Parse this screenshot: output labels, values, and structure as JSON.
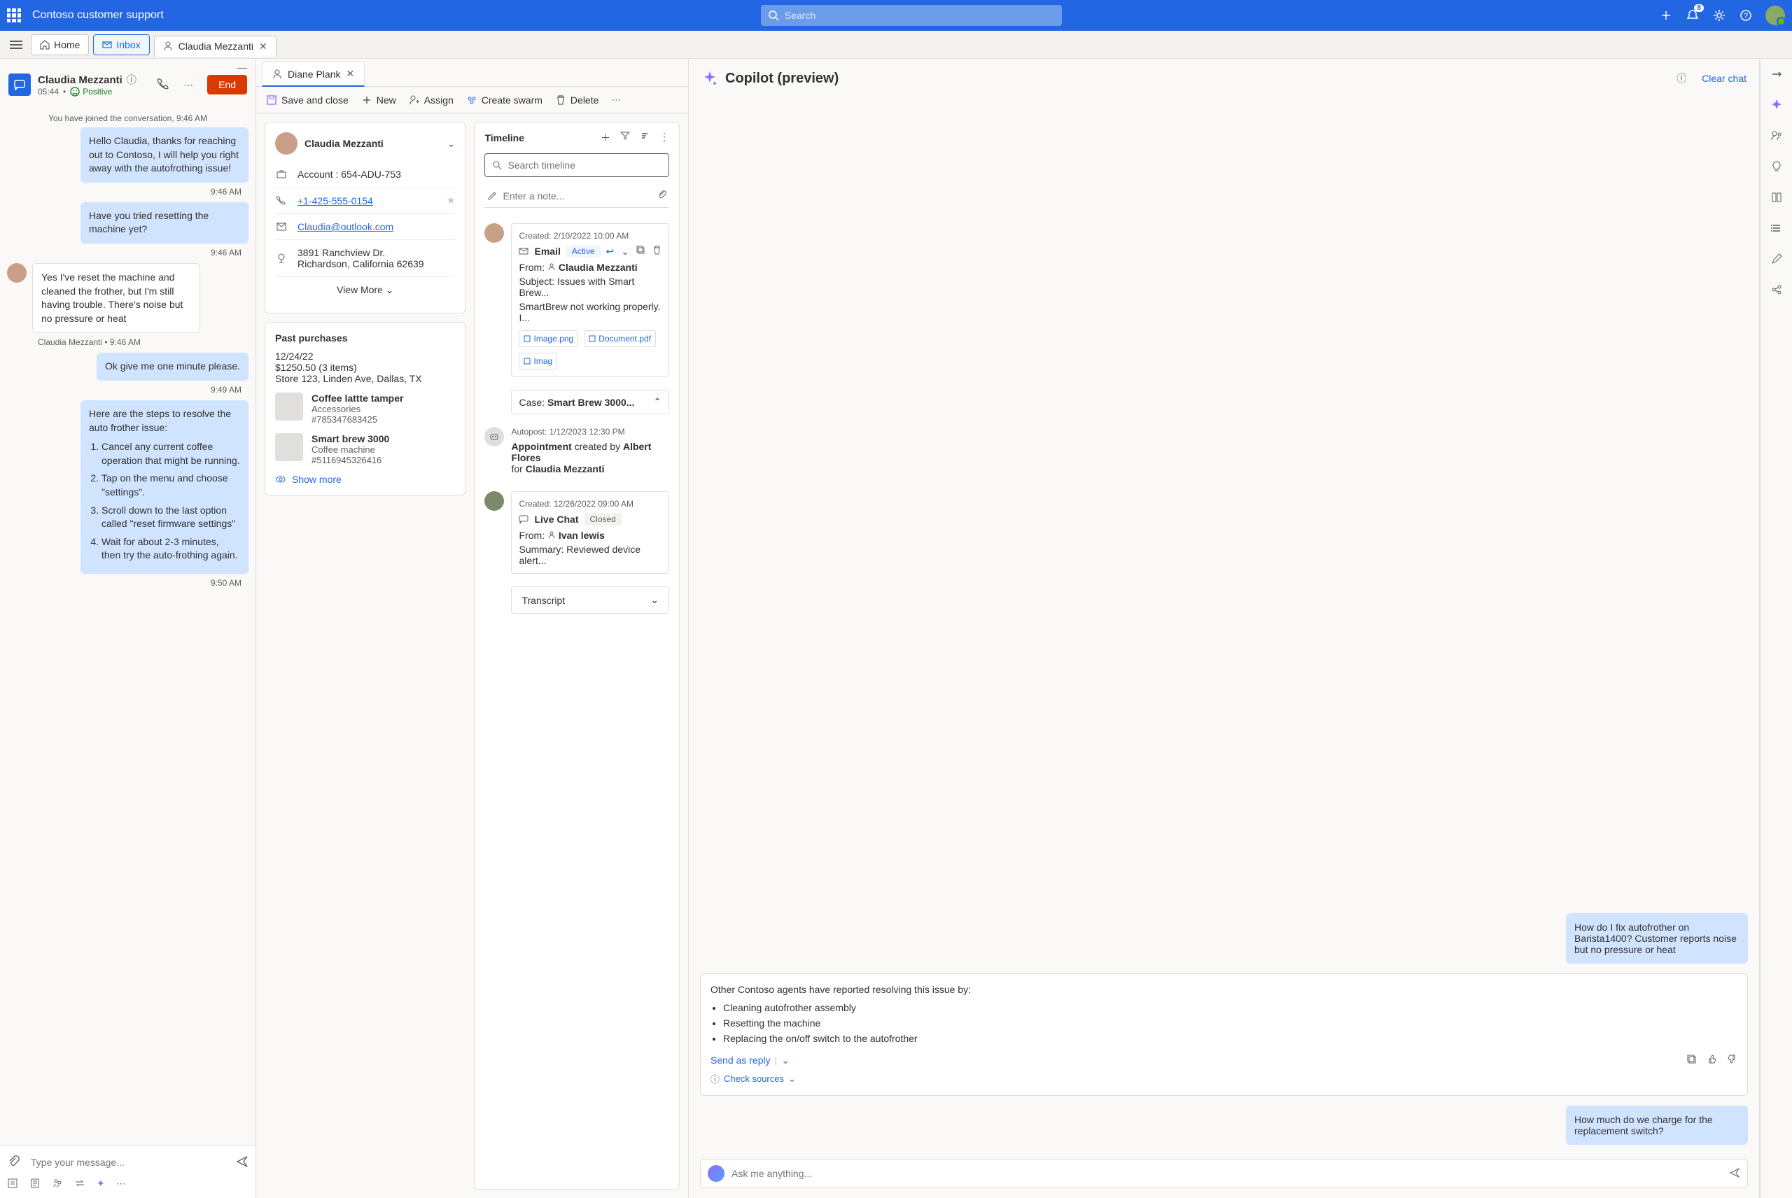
{
  "topbar": {
    "app_title": "Contoso customer support",
    "search_placeholder": "Search",
    "notification_count": "8"
  },
  "nav": {
    "home": "Home",
    "inbox": "Inbox",
    "tab_customer": "Claudia Mezzanti"
  },
  "chat": {
    "customer_name": "Claudia Mezzanti",
    "duration": "05:44",
    "sentiment": "Positive",
    "end": "End",
    "system_msg": "You have joined the conversation, 9:46 AM",
    "msg1": "Hello Claudia, thanks for reaching out to Contoso, I will help you right away with the autofrothing issue!",
    "t1": "9:46 AM",
    "msg2": "Have you tried resetting the machine yet?",
    "t2": "9:46 AM",
    "msg3": "Yes I've reset the machine and cleaned the frother, but I'm still having trouble. There's noise but no pressure or heat",
    "sender3": "Claudia Mezzanti",
    "t3": "9:46 AM",
    "msg4": "Ok give me one minute please.",
    "t4": "9:49 AM",
    "msg5_intro": "Here are the steps to resolve the auto frother issue:",
    "steps": [
      "Cancel any current coffee operation that might be running.",
      "Tap on the menu and choose \"settings\".",
      "Scroll down to the last option called \"reset firmware settings\"",
      "Wait for about 2-3 minutes, then try the auto-frothing again."
    ],
    "t5": "9:50 AM",
    "input_placeholder": "Type your message..."
  },
  "subtab": {
    "name": "Diane Plank"
  },
  "toolbar": {
    "save": "Save and close",
    "new": "New",
    "assign": "Assign",
    "swarm": "Create swarm",
    "delete": "Delete"
  },
  "customer_card": {
    "name": "Claudia Mezzanti",
    "account_label": "Account : 654-ADU-753",
    "phone": "+1-425-555-0154",
    "email": "Claudia@outlook.com",
    "addr1": "3891 Ranchview Dr.",
    "addr2": "Richardson, California 62639",
    "view_more": "View More"
  },
  "past": {
    "title": "Past purchases",
    "date": "12/24/22",
    "total": "$1250.50 (3 items)",
    "store": "Store 123, Linden Ave, Dallas, TX",
    "p1_name": "Coffee lattte tamper",
    "p1_cat": "Accessories",
    "p1_num": "#785347683425",
    "p2_name": "Smart brew 3000",
    "p2_cat": "Coffee machine",
    "p2_num": "#5116945326416",
    "show_more": "Show more"
  },
  "timeline": {
    "title": "Timeline",
    "search_placeholder": "Search timeline",
    "note_placeholder": "Enter a note...",
    "item1": {
      "created": "Created:  2/10/2022  10:00 AM",
      "type": "Email",
      "status": "Active",
      "from_label": "From:",
      "from": "Claudia Mezzanti",
      "subject": "Subject: Issues with Smart Brew...",
      "body": "SmartBrew not working properly. I...",
      "att1": "Image.png",
      "att2": "Document.pdf",
      "att3": "Imag",
      "case_label": "Case:",
      "case": "Smart Brew 3000..."
    },
    "item2": {
      "meta": "Autopost:  1/12/2023  12:30 PM",
      "type": "Appointment",
      "action": " created by ",
      "by": "Albert Flores",
      "for_label": "for ",
      "for": "Claudia Mezzanti"
    },
    "item3": {
      "created": "Created:  12/26/2022  09:00 AM",
      "type": "Live Chat",
      "status": "Closed",
      "from_label": "From:",
      "from": "Ivan lewis",
      "summary": "Summary: Reviewed device alert..."
    },
    "transcript": "Transcript"
  },
  "copilot": {
    "title": "Copilot (preview)",
    "clear": "Clear chat",
    "user1": "How do I fix autofrother on Barista1400? Customer reports noise but no pressure or heat",
    "ai_intro": "Other Contoso agents have reported resolving this issue by:",
    "ai_list": [
      "Cleaning autofrother assembly",
      "Resetting the machine",
      "Replacing the on/off switch to the autofrother"
    ],
    "send_reply": "Send as reply",
    "check_sources": "Check sources",
    "user2": "How much do we charge for the replacement switch?",
    "input_placeholder": "Ask me anything..."
  }
}
